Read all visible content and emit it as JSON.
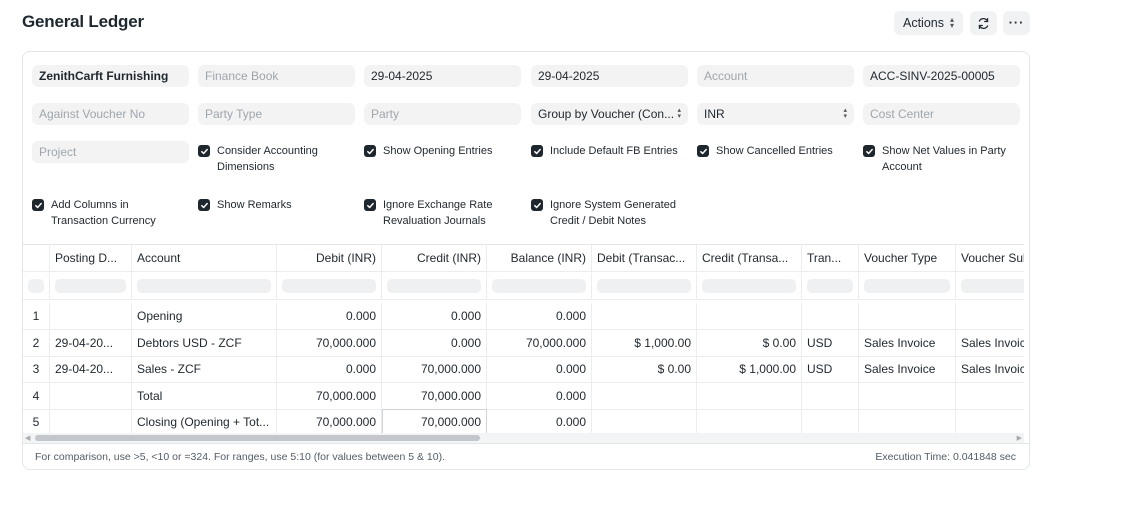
{
  "page": {
    "title": "General Ledger"
  },
  "header": {
    "actions_label": "Actions",
    "more_label": "···"
  },
  "filters": {
    "company": "ZenithCarft Furnishing",
    "finance_book": "Finance Book",
    "from_date": "29-04-2025",
    "to_date": "29-04-2025",
    "account": "Account",
    "voucher_no": "ACC-SINV-2025-00005",
    "against_voucher_no": "Against Voucher No",
    "party_type": "Party Type",
    "party": "Party",
    "group_by": "Group by Voucher (Con...",
    "currency": "INR",
    "cost_center": "Cost Center",
    "project": "Project"
  },
  "checkboxes": {
    "consider_dims": "Consider Accounting Dimensions",
    "show_opening": "Show Opening Entries",
    "include_default_fb": "Include Default FB Entries",
    "show_cancelled": "Show Cancelled Entries",
    "show_net_values": "Show Net Values in Party Account",
    "add_columns_txn": "Add Columns in Transaction Currency",
    "show_remarks": "Show Remarks",
    "ignore_exchange": "Ignore Exchange Rate Revaluation Journals",
    "ignore_system": "Ignore System Generated Credit / Debit Notes"
  },
  "table": {
    "columns": [
      "Posting D...",
      "Account",
      "Debit (INR)",
      "Credit (INR)",
      "Balance (INR)",
      "Debit (Transac...",
      "Credit (Transa...",
      "Tran...",
      "Voucher Type",
      "Voucher Subt"
    ],
    "rows": [
      {
        "num": "1",
        "date": "",
        "account": "Opening",
        "debit": "0.000",
        "credit": "0.000",
        "balance": "0.000",
        "debit_txn": "",
        "credit_txn": "",
        "txn_cur": "",
        "voucher_type": "",
        "voucher_subtype": ""
      },
      {
        "num": "2",
        "date": "29-04-20...",
        "account": "Debtors USD - ZCF",
        "debit": "70,000.000",
        "credit": "0.000",
        "balance": "70,000.000",
        "debit_txn": "$ 1,000.00",
        "credit_txn": "$ 0.00",
        "txn_cur": "USD",
        "voucher_type": "Sales Invoice",
        "voucher_subtype": "Sales Invoice"
      },
      {
        "num": "3",
        "date": "29-04-20...",
        "account": "Sales - ZCF",
        "debit": "0.000",
        "credit": "70,000.000",
        "balance": "0.000",
        "debit_txn": "$ 0.00",
        "credit_txn": "$ 1,000.00",
        "txn_cur": "USD",
        "voucher_type": "Sales Invoice",
        "voucher_subtype": "Sales Invoice"
      },
      {
        "num": "4",
        "date": "",
        "account": "Total",
        "debit": "70,000.000",
        "credit": "70,000.000",
        "balance": "0.000",
        "debit_txn": "",
        "credit_txn": "",
        "txn_cur": "",
        "voucher_type": "",
        "voucher_subtype": ""
      },
      {
        "num": "5",
        "date": "",
        "account": "Closing (Opening + Tot...",
        "debit": "70,000.000",
        "credit": "70,000.000",
        "balance": "0.000",
        "debit_txn": "",
        "credit_txn": "",
        "txn_cur": "",
        "voucher_type": "",
        "voucher_subtype": ""
      }
    ]
  },
  "footer": {
    "note": "For comparison, use >5, <10 or =324. For ranges, use 5:10 (for values between 5 & 10).",
    "execution_time": "Execution Time: 0.041848 sec"
  }
}
